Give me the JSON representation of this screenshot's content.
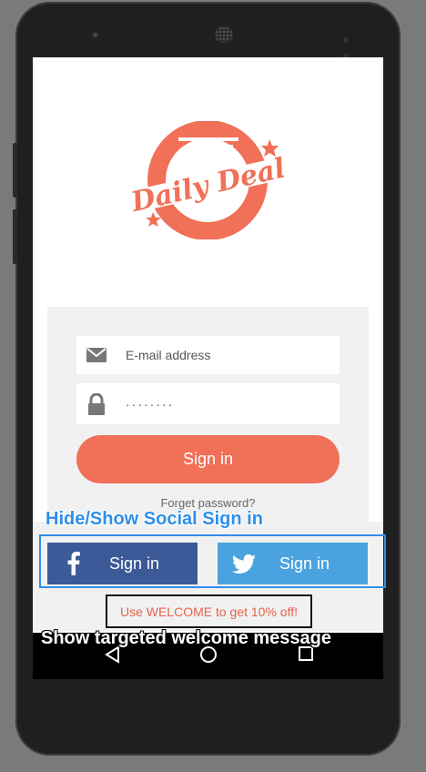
{
  "app": {
    "logo_text": "Daily Deal",
    "accent_color": "#f07058",
    "facebook_color": "#3c5a98",
    "twitter_color": "#4aa3df"
  },
  "login": {
    "email_placeholder": "E-mail address",
    "password_value": "········",
    "signin_label": "Sign in",
    "forgot_label": "Forget password?"
  },
  "social": {
    "facebook_label": "Sign in",
    "twitter_label": "Sign in",
    "facebook_icon": "facebook-icon",
    "twitter_icon": "twitter-icon"
  },
  "promo": {
    "text": "Use WELCOME to get 10% off!"
  },
  "annotations": {
    "social": "Hide/Show Social Sign in",
    "welcome": "Show targeted welcome message"
  },
  "navbar": {
    "icons": [
      "back-icon",
      "home-icon",
      "recents-icon"
    ]
  }
}
